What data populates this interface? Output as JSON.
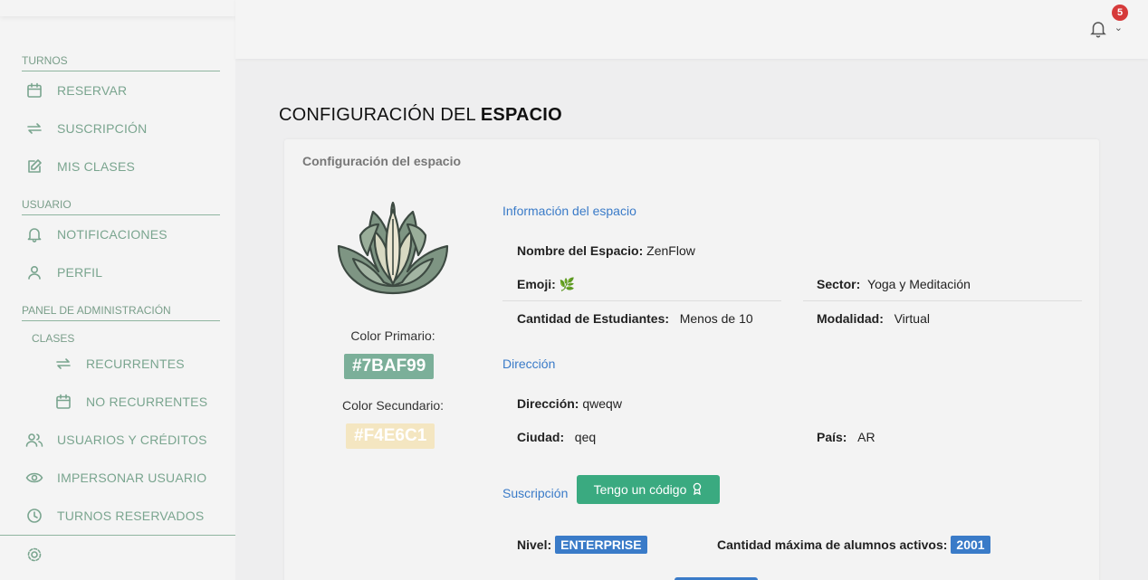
{
  "sidebar": {
    "sections": {
      "turnos": "TURNOS",
      "usuario": "USUARIO",
      "admin": "PANEL DE ADMINISTRACIÓN",
      "clases": "CLASES"
    },
    "items": {
      "reservar": "RESERVAR",
      "suscripcion": "SUSCRIPCIÓN",
      "mis_clases": "MIS CLASES",
      "notificaciones": "NOTIFICACIONES",
      "perfil": "PERFIL",
      "recurrentes": "RECURRENTES",
      "no_recurrentes": "NO RECURRENTES",
      "usuarios_creditos": "USUARIOS Y CRÉDITOS",
      "impersonar": "IMPERSONAR USUARIO",
      "turnos_reservados": "TURNOS RESERVADOS"
    },
    "accent_color": "#7aa58f"
  },
  "header": {
    "notification_count": "5",
    "chevron": "⌄"
  },
  "page": {
    "title_plain": "CONFIGURACIÓN DEL ",
    "title_bold": "ESPACIO"
  },
  "card": {
    "header": "Configuración del espacio",
    "colors": {
      "primary_label": "Color Primario:",
      "primary_value": "#7BAF99",
      "secondary_label": "Color Secundario:",
      "secondary_value": "#F4E6C1"
    },
    "info": {
      "title": "Información del espacio",
      "name_label": "Nombre del Espacio:",
      "name_value": "ZenFlow",
      "emoji_label": "Emoji:",
      "emoji_value": "🌿",
      "sector_label": "Sector:",
      "sector_value": "Yoga y Meditación",
      "students_label": "Cantidad de Estudiantes:",
      "students_value": "Menos de 10",
      "modality_label": "Modalidad:",
      "modality_value": "Virtual"
    },
    "address": {
      "title": "Dirección",
      "address_label": "Dirección:",
      "address_value": "qweqw",
      "city_label": "Ciudad:",
      "city_value": "qeq",
      "country_label": "País:",
      "country_value": "AR"
    },
    "subscription": {
      "title": "Suscripción",
      "code_button": "Tengo un código",
      "level_label": "Nivel:",
      "level_value": "ENTERPRISE",
      "max_label": "Cantidad máxima de alumnos activos:",
      "max_value": "2001"
    }
  }
}
